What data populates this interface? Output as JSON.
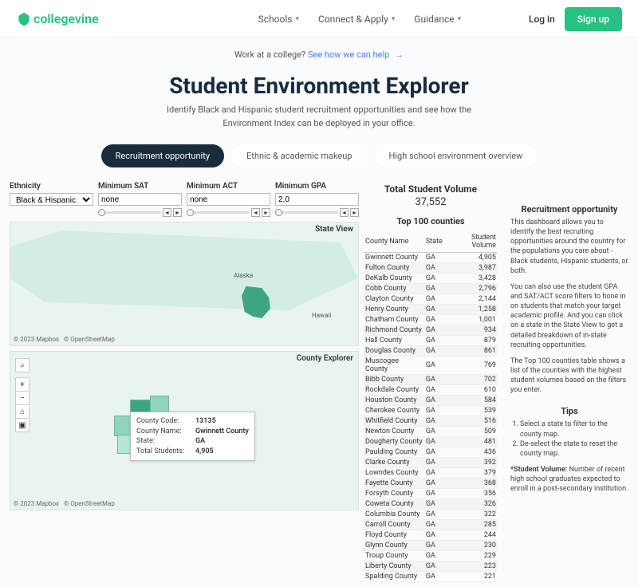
{
  "header": {
    "logo": "collegevine",
    "nav": [
      "Schools",
      "Connect & Apply",
      "Guidance"
    ],
    "login": "Log in",
    "signup": "Sign up"
  },
  "promo": {
    "q": "Work at a college?",
    "link": "See how we can help"
  },
  "title": "Student Environment Explorer",
  "subtitle": "Identify Black and Hispanic student recruitment opportunities and see how the Environment Index can be deployed in your office.",
  "tabs": [
    "Recruitment opportunity",
    "Ethnic & academic makeup",
    "High school environment overview"
  ],
  "filters": {
    "ethnicity": {
      "label": "Ethnicity",
      "value": "Black & Hispanic"
    },
    "sat": {
      "label": "Minimum SAT",
      "value": "none"
    },
    "act": {
      "label": "Minimum ACT",
      "value": "none"
    },
    "gpa": {
      "label": "Minimum GPA",
      "value": "2.0"
    }
  },
  "state_map": {
    "label": "State View",
    "alaska": "Alaska",
    "hawaii": "Hawaii",
    "attrib": [
      "© 2023 Mapbox",
      "© OpenStreetMap"
    ]
  },
  "county_map": {
    "label": "County Explorer",
    "attrib": [
      "© 2023 Mapbox",
      "© OpenStreetMap"
    ],
    "tooltip": {
      "code_l": "County Code:",
      "code_v": "13135",
      "name_l": "County Name:",
      "name_v": "Gwinnett County",
      "state_l": "State:",
      "state_v": "GA",
      "stu_l": "Total Students:",
      "stu_v": "4,905"
    }
  },
  "totals": {
    "label": "Total Student Volume",
    "value": "37,552"
  },
  "counties": {
    "title": "Top 100 counties",
    "headers": [
      "County Name",
      "State",
      "Student Volume"
    ],
    "rows": [
      [
        "Gwinnett County",
        "GA",
        "4,905"
      ],
      [
        "Fulton County",
        "GA",
        "3,987"
      ],
      [
        "DeKalb County",
        "GA",
        "3,428"
      ],
      [
        "Cobb County",
        "GA",
        "2,796"
      ],
      [
        "Clayton County",
        "GA",
        "2,144"
      ],
      [
        "Henry County",
        "GA",
        "1,258"
      ],
      [
        "Chatham County",
        "GA",
        "1,001"
      ],
      [
        "Richmond County",
        "GA",
        "934"
      ],
      [
        "Hall County",
        "GA",
        "879"
      ],
      [
        "Douglas County",
        "GA",
        "861"
      ],
      [
        "Muscogee County",
        "GA",
        "769"
      ],
      [
        "Bibb County",
        "GA",
        "702"
      ],
      [
        "Rockdale County",
        "GA",
        "610"
      ],
      [
        "Houston County",
        "GA",
        "584"
      ],
      [
        "Cherokee County",
        "GA",
        "539"
      ],
      [
        "Whitfield County",
        "GA",
        "516"
      ],
      [
        "Newton County",
        "GA",
        "509"
      ],
      [
        "Dougherty County",
        "GA",
        "481"
      ],
      [
        "Paulding County",
        "GA",
        "436"
      ],
      [
        "Clarke County",
        "GA",
        "392"
      ],
      [
        "Lowndes County",
        "GA",
        "379"
      ],
      [
        "Fayette County",
        "GA",
        "368"
      ],
      [
        "Forsyth County",
        "GA",
        "356"
      ],
      [
        "Coweta County",
        "GA",
        "326"
      ],
      [
        "Columbia County",
        "GA",
        "322"
      ],
      [
        "Carroll County",
        "GA",
        "285"
      ],
      [
        "Floyd County",
        "GA",
        "244"
      ],
      [
        "Glynn County",
        "GA",
        "230"
      ],
      [
        "Troup County",
        "GA",
        "229"
      ],
      [
        "Liberty County",
        "GA",
        "223"
      ],
      [
        "Spalding County",
        "GA",
        "221"
      ]
    ]
  },
  "info": {
    "title1": "Recruitment opportunity",
    "p1": "This dashboard allows you to identify the best recruiting opportunities around the country for the populations you care about - Black students, Hispanic students, or both.",
    "p2": "You can also use the student GPA and SAT/ACT score filters to hone in on students that match your target academic profile. And you can click on a state in the State View to get a detailed breakdown of in-state recruiting opportunities.",
    "p3": "The Top 100 counties table shows a list of the counties with the highest student volumes based on the filters you enter.",
    "title2": "Tips",
    "tip1": "Select a state to filter to the county map.",
    "tip2": "De-select the state to reset the county map.",
    "sv_l": "*Student Volume:",
    "sv": "Number of recent high school graduates expected to enroll in a post-secondary institution."
  }
}
